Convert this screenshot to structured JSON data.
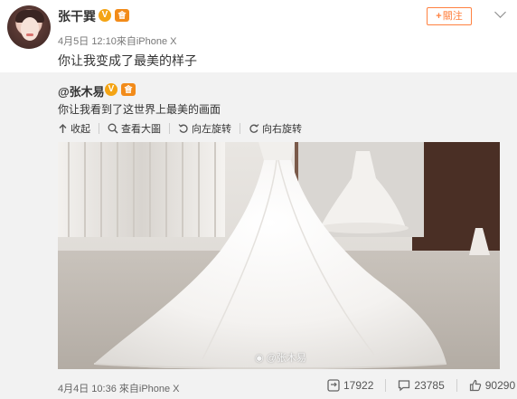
{
  "post": {
    "author": "张干巽",
    "vip_badge": "V",
    "crown_badge": "會",
    "date": "4月5日",
    "time_source": "12:10來自iPhone X",
    "content": "你让我变成了最美的样子",
    "follow_label": "關注",
    "follow_plus": "+"
  },
  "repost": {
    "author": "@张木易",
    "vip_badge": "V",
    "crown_badge": "會",
    "content": "你让我看到了这世界上最美的画面",
    "tools": {
      "collapse": "收起",
      "view_large": "查看大圖",
      "rotate_left": "向左旋转",
      "rotate_right": "向右旋转"
    },
    "watermark": "@张木易",
    "footer_time": "4月4日 10:36 來自iPhone X",
    "stats": {
      "reposts": "17922",
      "comments": "23785",
      "likes": "90290"
    }
  },
  "colors": {
    "accent_orange": "#ff8140",
    "vip_gold": "#f4a414",
    "panel_bg": "#f2f2f2"
  },
  "icons": [
    "chevron-down-icon",
    "collapse-icon",
    "zoom-icon",
    "rotate-left-icon",
    "rotate-right-icon",
    "repost-icon",
    "comment-icon",
    "like-icon"
  ]
}
